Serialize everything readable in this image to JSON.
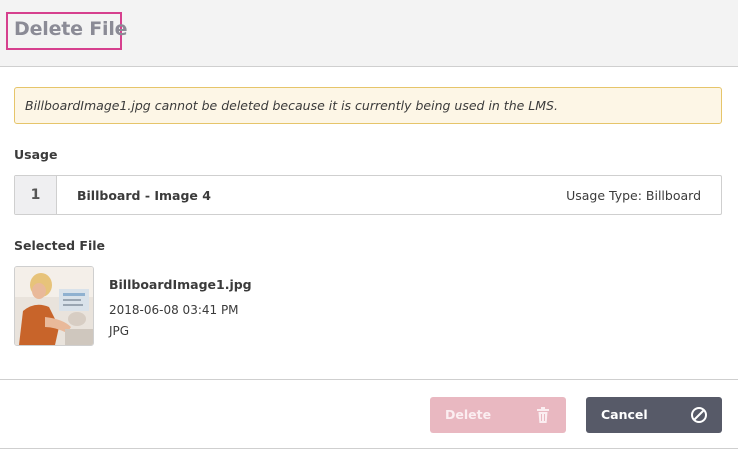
{
  "dialog": {
    "title": "Delete File"
  },
  "warning": {
    "message": "BillboardImage1.jpg cannot be deleted because it is currently being used in the LMS."
  },
  "usage": {
    "section_label": "Usage",
    "items": [
      {
        "index": "1",
        "name": "Billboard - Image 4",
        "usage_type": "Usage Type: Billboard"
      }
    ]
  },
  "selected_file": {
    "section_label": "Selected File",
    "name": "BillboardImage1.jpg",
    "date": "2018-06-08 03:41 PM",
    "type": "JPG",
    "thumbnail_icon": "photo-thumbnail"
  },
  "actions": {
    "delete_label": "Delete",
    "delete_icon": "trash-icon",
    "delete_disabled": true,
    "cancel_label": "Cancel",
    "cancel_icon": "ban-icon"
  },
  "colors": {
    "highlight": "#d6408e",
    "warning_bg": "#fdf6e6",
    "warning_border": "#e6c56a",
    "delete_disabled": "#e9b8c1",
    "cancel_bg": "#575a68"
  }
}
